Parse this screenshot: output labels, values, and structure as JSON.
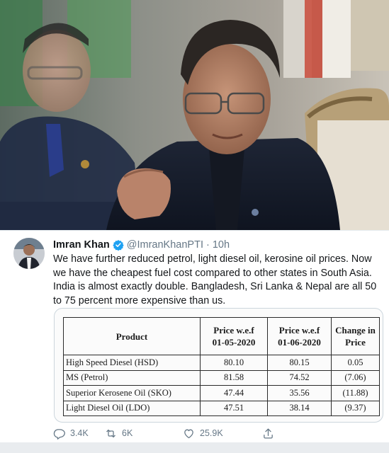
{
  "photo": {
    "description_icon": "speaker-photo"
  },
  "tweet": {
    "author_name": "Imran Khan",
    "handle": "@ImranKhanPTI",
    "separator": "·",
    "time": "10h",
    "text": "We have further reduced petrol, light diesel oil, kerosine oil prices. Now we have the cheapest fuel cost compared to other states in South Asia. India is almost exactly double. Bangladesh, Sri Lanka & Nepal are all 50 to 75 percent more expensive than us.",
    "verified_color": "#1da1f2"
  },
  "price_table": {
    "headers": {
      "product": "Product",
      "price_old": "Price w.e.f",
      "price_old_date": "01-05-2020",
      "price_new": "Price w.e.f",
      "price_new_date": "01-06-2020",
      "change_line1": "Change in",
      "change_line2": "Price"
    },
    "rows": [
      {
        "product": "High Speed Diesel (HSD)",
        "old": "80.10",
        "new": "80.15",
        "change": "0.05"
      },
      {
        "product": "MS (Petrol)",
        "old": "81.58",
        "new": "74.52",
        "change": "(7.06)"
      },
      {
        "product": "Superior Kerosene Oil (SKO)",
        "old": "47.44",
        "new": "35.56",
        "change": "(11.88)"
      },
      {
        "product": "Light Diesel Oil (LDO)",
        "old": "47.51",
        "new": "38.14",
        "change": "(9.37)"
      }
    ]
  },
  "actions": {
    "replies": "3.4K",
    "retweets": "6K",
    "likes": "25.9K",
    "share_icon": "share-icon"
  }
}
